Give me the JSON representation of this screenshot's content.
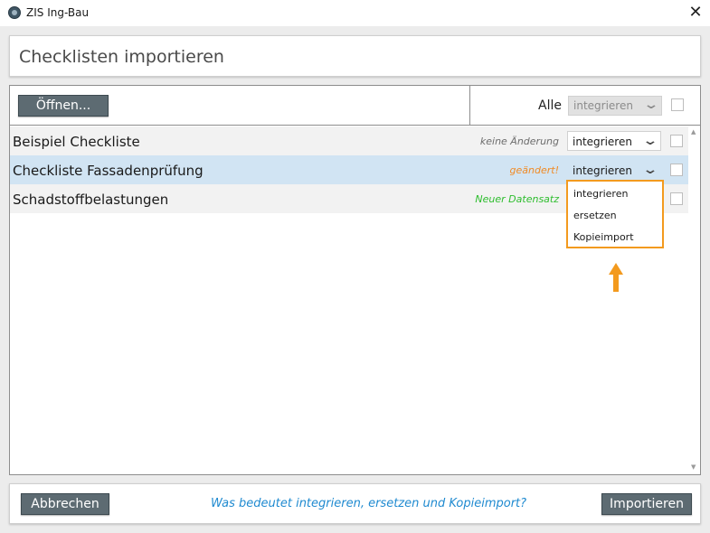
{
  "window": {
    "title": "ZIS Ing-Bau",
    "close_glyph": "✕"
  },
  "header": {
    "title": "Checklisten importieren"
  },
  "toolbar": {
    "open_label": "Öffnen...",
    "all_label": "Alle",
    "all_select_value": "integrieren"
  },
  "rows": [
    {
      "name": "Beispiel Checkliste",
      "status": "keine Änderung",
      "status_color": "#6d6d6d",
      "mode": "integrieren",
      "checked": false
    },
    {
      "name": "Checkliste Fassadenprüfung",
      "status": "geändert!",
      "status_color": "#f08a24",
      "mode": "integrieren",
      "checked": false,
      "selected": true
    },
    {
      "name": "Schadstoffbelastungen",
      "status": "Neuer Datensatz",
      "status_color": "#2ebd2e",
      "mode": "",
      "checked": false
    }
  ],
  "dropdown": {
    "options": [
      "integrieren",
      "ersetzen",
      "Kopieimport"
    ],
    "highlight_color": "#f39a1e"
  },
  "icons": {
    "chevron": "chevron-down-icon",
    "scroll_up": "▲",
    "scroll_down": "▼"
  },
  "footer": {
    "cancel_label": "Abbrechen",
    "help_link": "Was bedeutet integrieren, ersetzen und Kopieimport?",
    "import_label": "Importieren"
  },
  "colors": {
    "button_bg": "#5d6b72",
    "selected_row_bg": "#d1e4f3",
    "link": "#1f8ad0"
  }
}
